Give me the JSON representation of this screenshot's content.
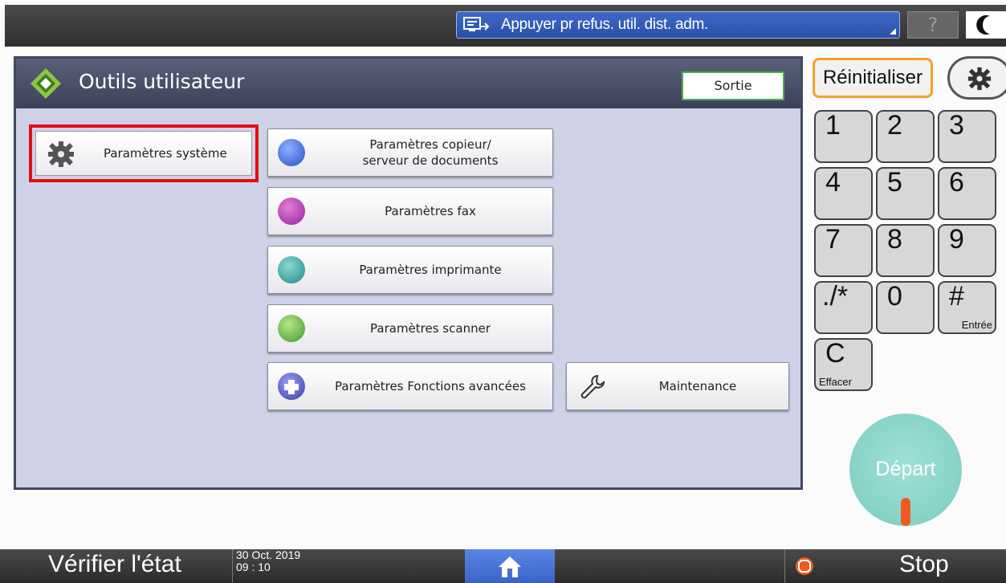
{
  "topbar": {
    "notice": "Appuyer pr refus. util. dist. adm.",
    "help_label": "?"
  },
  "panel": {
    "title": "Outils utilisateur",
    "exit_label": "Sortie",
    "system_settings": "Paramètres système",
    "copier_line1": "Paramètres copieur/",
    "copier_line2": "serveur de documents",
    "fax": "Paramètres fax",
    "printer": "Paramètres imprimante",
    "scanner": "Paramètres scanner",
    "advanced": "Paramètres Fonctions avancées",
    "maintenance": "Maintenance"
  },
  "keypad": {
    "reset_label": "Réinitialiser",
    "keys": [
      "1",
      "2",
      "3",
      "4",
      "5",
      "6",
      "7",
      "8",
      "9",
      "./*",
      "0",
      "#"
    ],
    "enter_label": "Entrée",
    "clear_key": "C",
    "clear_label": "Effacer",
    "start_label": "Départ"
  },
  "bottombar": {
    "status_label": "Vérifier l'état",
    "date": "30 Oct. 2019",
    "time": "09 : 10",
    "stop_label": "Stop"
  },
  "colors": {
    "highlight": "#e01010",
    "reset_border": "#f0a428",
    "start": "#8fd8cf",
    "notice": "#3a5fbf"
  }
}
